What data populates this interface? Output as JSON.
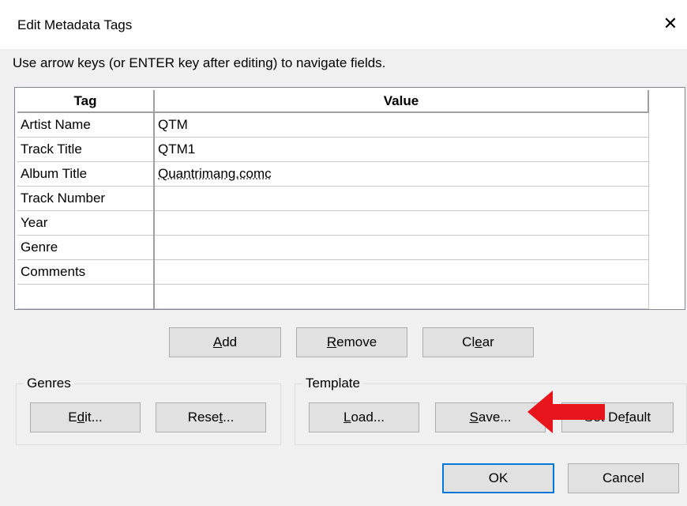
{
  "window": {
    "title": "Edit Metadata Tags",
    "close_glyph": "✕"
  },
  "instruction": "Use arrow keys (or ENTER key after editing) to navigate fields.",
  "table": {
    "headers": [
      "Tag",
      "Value"
    ],
    "rows": [
      {
        "tag": "Artist Name",
        "value": "QTM"
      },
      {
        "tag": "Track Title",
        "value": "QTM1"
      },
      {
        "tag": "Album Title",
        "value": "Quantrimang.comc"
      },
      {
        "tag": "Track Number",
        "value": ""
      },
      {
        "tag": "Year",
        "value": ""
      },
      {
        "tag": "Genre",
        "value": ""
      },
      {
        "tag": "Comments",
        "value": ""
      },
      {
        "tag": "",
        "value": ""
      }
    ]
  },
  "buttons": {
    "add": {
      "pre": "",
      "key": "A",
      "post": "dd"
    },
    "remove": {
      "pre": "",
      "key": "R",
      "post": "emove"
    },
    "clear": {
      "pre": "Cl",
      "key": "e",
      "post": "ar"
    },
    "edit": {
      "pre": "E",
      "key": "d",
      "post": "it..."
    },
    "reset": {
      "pre": "Rese",
      "key": "t",
      "post": "..."
    },
    "load": {
      "pre": "",
      "key": "L",
      "post": "oad..."
    },
    "save": {
      "pre": "",
      "key": "S",
      "post": "ave..."
    },
    "set_default": {
      "pre": "Set De",
      "key": "f",
      "post": "ault"
    },
    "ok": "OK",
    "cancel": "Cancel"
  },
  "groups": {
    "genres": "Genres",
    "template": "Template"
  },
  "colors": {
    "accent": "#0078d7",
    "annotation_arrow": "#e8141b"
  }
}
